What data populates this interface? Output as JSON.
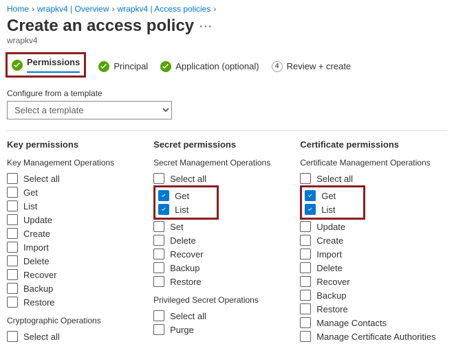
{
  "breadcrumb": {
    "items": [
      "Home",
      "wrapkv4 | Overview",
      "wrapkv4 | Access policies"
    ]
  },
  "page": {
    "title": "Create an access policy",
    "subtitle": "wrapkv4",
    "ellipsis": "···"
  },
  "steps": {
    "s1": {
      "label": "Permissions"
    },
    "s2": {
      "label": "Principal"
    },
    "s3": {
      "label": "Application (optional)"
    },
    "s4": {
      "num": "4",
      "label": "Review + create"
    }
  },
  "template": {
    "label": "Configure from a template",
    "placeholder": "Select a template"
  },
  "columns": {
    "key": {
      "heading": "Key permissions",
      "group1": {
        "title": "Key Management Operations",
        "select_all": "Select all",
        "ops": [
          "Get",
          "List",
          "Update",
          "Create",
          "Import",
          "Delete",
          "Recover",
          "Backup",
          "Restore"
        ]
      },
      "group2": {
        "title": "Cryptographic Operations",
        "select_all": "Select all"
      }
    },
    "secret": {
      "heading": "Secret permissions",
      "group1": {
        "title": "Secret Management Operations",
        "select_all": "Select all",
        "ops": [
          "Get",
          "List",
          "Set",
          "Delete",
          "Recover",
          "Backup",
          "Restore"
        ]
      },
      "group2": {
        "title": "Privileged Secret Operations",
        "select_all": "Select all",
        "ops": [
          "Purge"
        ]
      }
    },
    "cert": {
      "heading": "Certificate permissions",
      "group1": {
        "title": "Certificate Management Operations",
        "select_all": "Select all",
        "ops": [
          "Get",
          "List",
          "Update",
          "Create",
          "Import",
          "Delete",
          "Recover",
          "Backup",
          "Restore",
          "Manage Contacts",
          "Manage Certificate Authorities"
        ]
      }
    }
  },
  "checked": {
    "secret.0": true,
    "secret.1": true,
    "cert.0": true,
    "cert.1": true
  }
}
